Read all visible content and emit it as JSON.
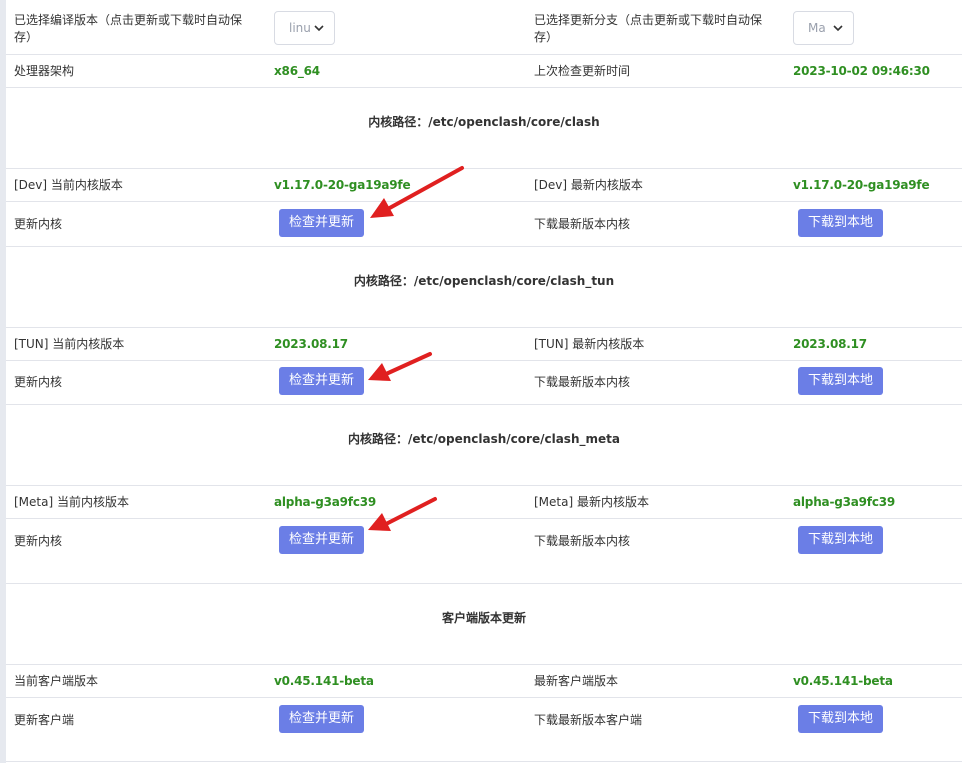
{
  "select_row": {
    "compile_label": "已选择编译版本（点击更新或下载时自动保存）",
    "compile_value": "linu",
    "branch_label": "已选择更新分支（点击更新或下载时自动保存）",
    "branch_value": "Ma"
  },
  "arch_row": {
    "arch_label": "处理器架构",
    "arch_value": "x86_64",
    "last_check_label": "上次检查更新时间",
    "last_check_value": "2023-10-02 09:46:30"
  },
  "dev": {
    "path_header": "内核路径：/etc/openclash/core/clash",
    "current_label": "[Dev] 当前内核版本",
    "current_value": "v1.17.0-20-ga19a9fe",
    "latest_label": "[Dev] 最新内核版本",
    "latest_value": "v1.17.0-20-ga19a9fe",
    "update_label": "更新内核",
    "check_button": "检查并更新",
    "download_label": "下载最新版本内核",
    "download_button": "下载到本地"
  },
  "tun": {
    "path_header": "内核路径：/etc/openclash/core/clash_tun",
    "current_label": "[TUN] 当前内核版本",
    "current_value": "2023.08.17",
    "latest_label": "[TUN] 最新内核版本",
    "latest_value": "2023.08.17",
    "update_label": "更新内核",
    "check_button": "检查并更新",
    "download_label": "下载最新版本内核",
    "download_button": "下载到本地"
  },
  "meta": {
    "path_header": "内核路径：/etc/openclash/core/clash_meta",
    "current_label": "[Meta] 当前内核版本",
    "current_value": "alpha-g3a9fc39",
    "latest_label": "[Meta] 最新内核版本",
    "latest_value": "alpha-g3a9fc39",
    "update_label": "更新内核",
    "check_button": "检查并更新",
    "download_label": "下载最新版本内核",
    "download_button": "下载到本地"
  },
  "client": {
    "header": "客户端版本更新",
    "current_label": "当前客户端版本",
    "current_value": "v0.45.141-beta",
    "latest_label": "最新客户端版本",
    "latest_value": "v0.45.141-beta",
    "update_label": "更新客户端",
    "check_button": "检查并更新",
    "download_label": "下载最新版本客户端",
    "download_button": "下载到本地"
  },
  "colors": {
    "button": "#6b7ee6",
    "value_green": "#2f8f22",
    "annotation_arrow": "#e02020"
  },
  "icons": [
    "chevron-down-icon",
    "red-arrow-annotation"
  ]
}
